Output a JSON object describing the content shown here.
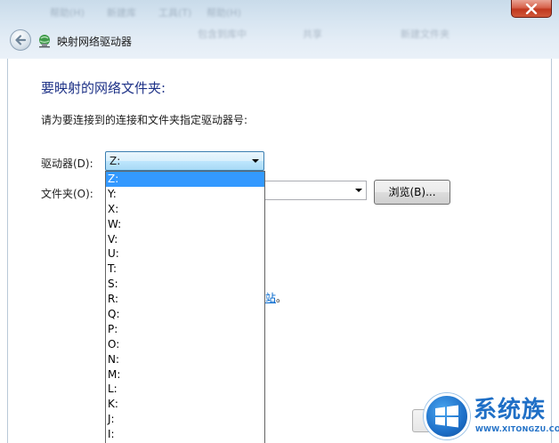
{
  "window": {
    "title": "映射网络驱动器",
    "blurred_background": [
      "帮助(H)",
      "新建库",
      "工具(T)",
      "帮助(H)",
      "包含到库中",
      "共享",
      "新建文件夹"
    ]
  },
  "page": {
    "heading": "要映射的网络文件夹:",
    "instruction": "请为要连接到的连接和文件夹指定驱动器号:"
  },
  "drive": {
    "label": "驱动器(D):",
    "selected": "Z:",
    "options": [
      "Z:",
      "Y:",
      "X:",
      "W:",
      "V:",
      "U:",
      "T:",
      "S:",
      "R:",
      "Q:",
      "P:",
      "O:",
      "N:",
      "M:",
      "L:",
      "K:",
      "J:",
      "I:"
    ]
  },
  "folder": {
    "label": "文件夹(O):",
    "value": ""
  },
  "browse_label": "浏览(B)...",
  "link_fragment": {
    "text": "站",
    "trailing": "。"
  },
  "watermark": {
    "title": "系统族",
    "url": "WWW.XITONGZU.COM"
  },
  "colors": {
    "heading": "#1e3287",
    "selection": "#3399ff",
    "link": "#0066cc"
  }
}
